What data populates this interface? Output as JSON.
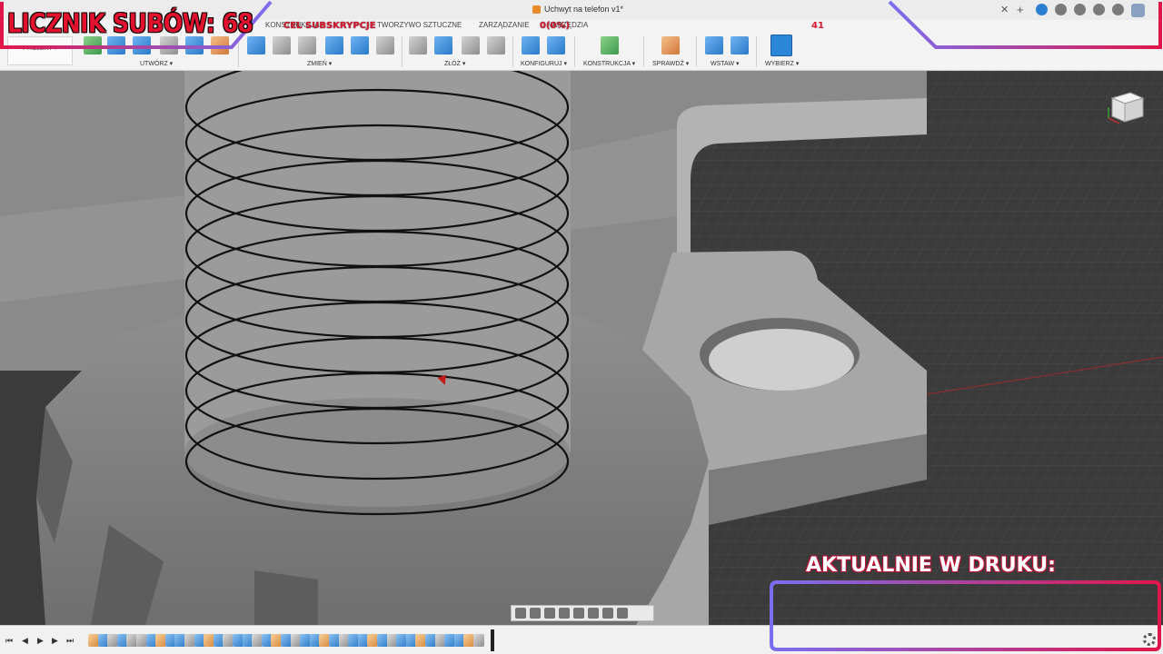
{
  "window": {
    "doc_title": "Uchwyt na telefon v1*"
  },
  "tabs": [
    "KONSTRUKCJA",
    "TWORZYWO SZTUCZNE",
    "ZARZĄDZANIE",
    "NARZĘDZIA"
  ],
  "ribbon": {
    "projekt": "PROJEKT",
    "groups": [
      "UTWÓRZ",
      "ZMIEŃ",
      "ZŁÓŻ",
      "KONFIGURUJ",
      "KONSTRUKCJA",
      "SPRAWDŹ",
      "WSTAW",
      "WYBIERZ"
    ]
  },
  "overlay": {
    "sub_counter": "LICZNIK SUBÓW: 68",
    "goal": "CEL SUBSKRYPCJE",
    "goal_progress": "0(0%)",
    "goal_target": "41",
    "printing": "AKTUALNIE W DRUKU:"
  },
  "colors": {
    "accent_red": "#e2122e",
    "frame_gradient_start": "#7a6ef0",
    "frame_gradient_end": "#e0164a",
    "selection_blue": "#2a86d6"
  },
  "icons": {
    "viewcube": "viewcube-icon",
    "timeline_play": "play-icon",
    "settings": "gear-icon"
  }
}
